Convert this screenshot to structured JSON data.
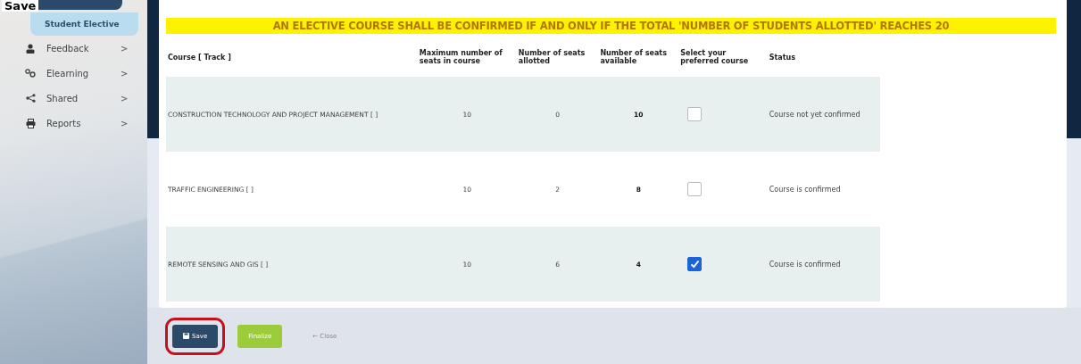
{
  "annotation": {
    "text": "Save"
  },
  "sidebar": {
    "items": [
      {
        "label": "Student Elective",
        "kind": "subitem",
        "selected": true
      },
      {
        "label": "Feedback",
        "kind": "menu",
        "selected": false,
        "arrow": ">"
      },
      {
        "label": "Elearning",
        "kind": "menu",
        "selected": false,
        "arrow": ">"
      },
      {
        "label": "Shared",
        "kind": "menu",
        "selected": false,
        "arrow": ">"
      },
      {
        "label": "Reports",
        "kind": "menu",
        "selected": false,
        "arrow": ">"
      }
    ]
  },
  "notice": "AN ELECTIVE COURSE SHALL BE CONFIRMED IF AND ONLY IF THE TOTAL 'NUMBER OF STUDENTS ALLOTTED' REACHES 20",
  "table": {
    "columns": [
      "Course [ Track ]",
      "Maximum number of seats in course",
      "Number of seats allotted",
      "Number of seats available",
      "Select your preferred course",
      "Status"
    ],
    "rows": [
      {
        "course": "CONSTRUCTION TECHNOLOGY AND PROJECT MANAGEMENT [ ]",
        "max_seats": "10",
        "allotted": "0",
        "available": "10",
        "checked": false,
        "status": "Course not yet confirmed"
      },
      {
        "course": "TRAFFIC ENGINEERING [ ]",
        "max_seats": "10",
        "allotted": "2",
        "available": "8",
        "checked": false,
        "status": "Course is confirmed"
      },
      {
        "course": "REMOTE SENSING AND GIS [ ]",
        "max_seats": "10",
        "allotted": "6",
        "available": "4",
        "checked": true,
        "status": "Course is confirmed"
      }
    ]
  },
  "buttons": [
    {
      "label": "Save",
      "kind": "primary",
      "highlighted": true
    },
    {
      "label": "Finalize",
      "kind": "success",
      "highlighted": false
    },
    {
      "label": "← Close",
      "kind": "link",
      "highlighted": false
    }
  ]
}
